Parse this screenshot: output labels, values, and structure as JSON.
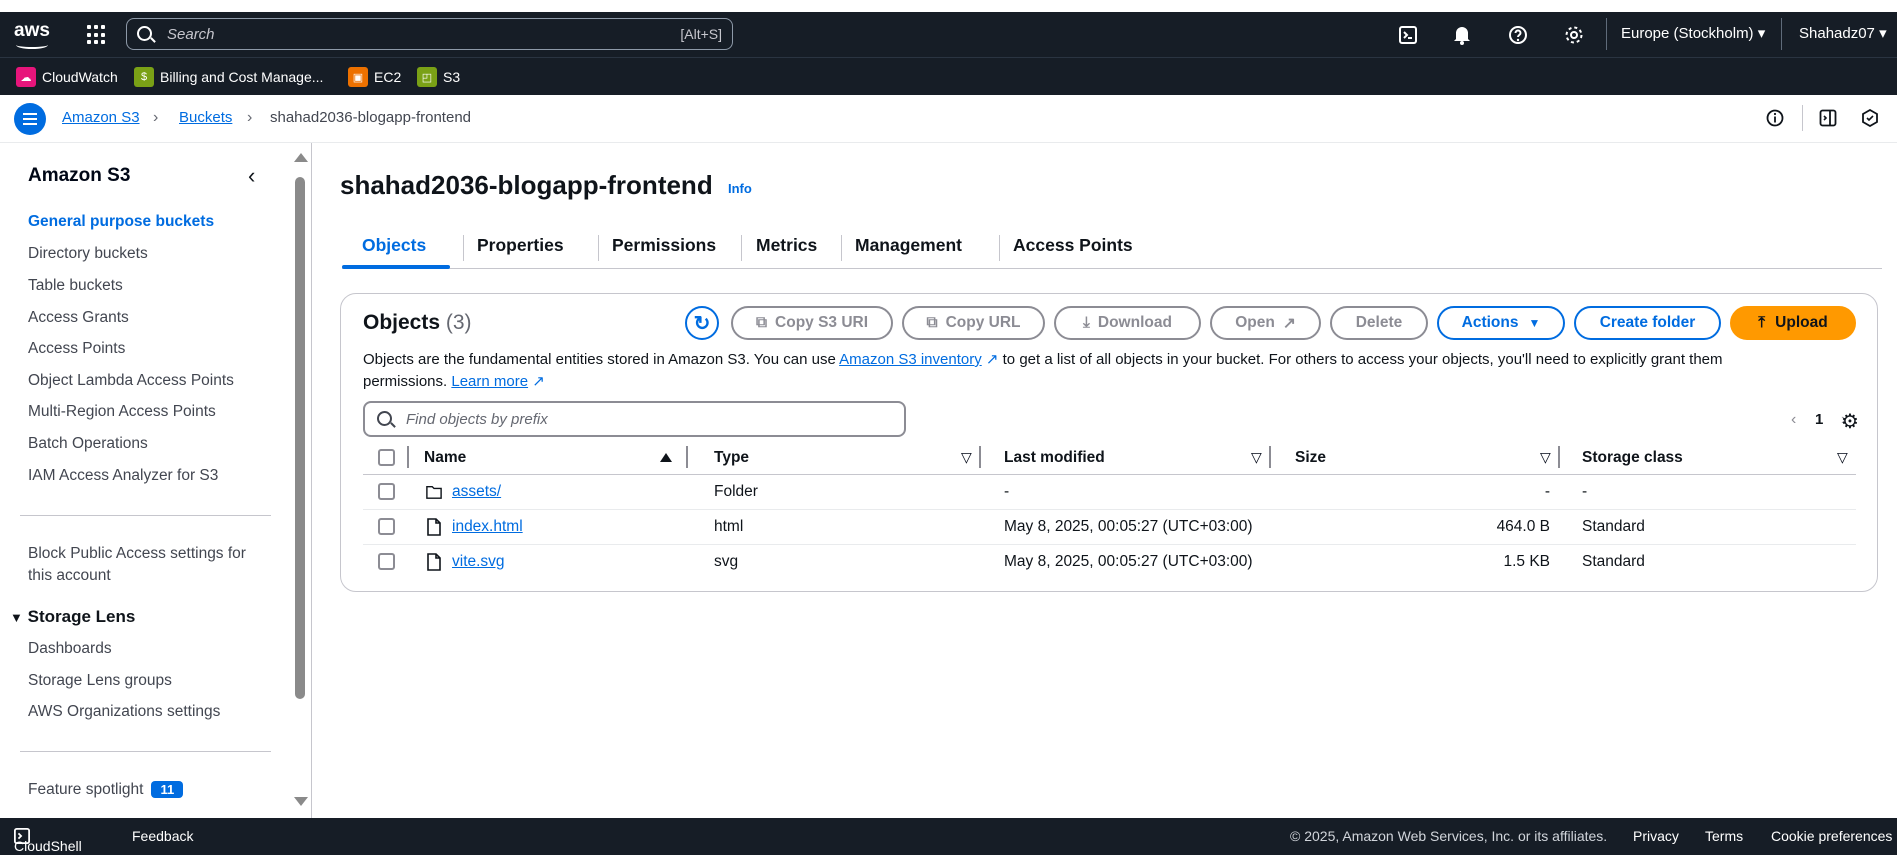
{
  "topbar": {
    "logo": "aws",
    "search_placeholder": "Search",
    "shortcut": "[Alt+S]",
    "region": "Europe (Stockholm)",
    "user": "Shahadz07"
  },
  "bookmarks": [
    {
      "label": "CloudWatch",
      "color": "#e7157b"
    },
    {
      "label": "Billing and Cost Manage...",
      "color": "#7aa116"
    },
    {
      "label": "EC2",
      "color": "#ed7100"
    },
    {
      "label": "S3",
      "color": "#7aa116"
    }
  ],
  "breadcrumb": {
    "items": [
      "Amazon S3",
      "Buckets"
    ],
    "current": "shahad2036-blogapp-frontend"
  },
  "sidebar": {
    "title": "Amazon S3",
    "items": [
      "General purpose buckets",
      "Directory buckets",
      "Table buckets",
      "Access Grants",
      "Access Points",
      "Object Lambda Access Points",
      "Multi-Region Access Points",
      "Batch Operations",
      "IAM Access Analyzer for S3"
    ],
    "block_public": "Block Public Access settings for",
    "block_public2": "this account",
    "storage_lens": "Storage Lens",
    "lens_items": [
      "Dashboards",
      "Storage Lens groups",
      "AWS Organizations settings"
    ],
    "spotlight": "Feature spotlight",
    "spotlight_count": "11"
  },
  "page": {
    "title": "shahad2036-blogapp-frontend",
    "info": "Info"
  },
  "tabs": [
    "Objects",
    "Properties",
    "Permissions",
    "Metrics",
    "Management",
    "Access Points"
  ],
  "objects": {
    "title": "Objects",
    "count": "(3)",
    "buttons": {
      "copy_uri": "Copy S3 URI",
      "copy_url": "Copy URL",
      "download": "Download",
      "open": "Open",
      "delete": "Delete",
      "actions": "Actions",
      "create_folder": "Create folder",
      "upload": "Upload"
    },
    "desc1": "Objects are the fundamental entities stored in Amazon S3. You can use ",
    "inventory": "Amazon S3 inventory",
    "desc2": " to get a list of all objects in your bucket. For others to access your objects, you'll need to explicitly grant them",
    "desc3": "permissions. ",
    "learn_more": "Learn more",
    "filter_placeholder": "Find objects by prefix",
    "page": "1",
    "columns": [
      "Name",
      "Type",
      "Last modified",
      "Size",
      "Storage class"
    ],
    "rows": [
      {
        "name": "assets/",
        "type": "Folder",
        "modified": "-",
        "size": "-",
        "class": "-"
      },
      {
        "name": "index.html",
        "type": "html",
        "modified": "May 8, 2025, 00:05:27 (UTC+03:00)",
        "size": "464.0 B",
        "class": "Standard"
      },
      {
        "name": "vite.svg",
        "type": "svg",
        "modified": "May 8, 2025, 00:05:27 (UTC+03:00)",
        "size": "1.5 KB",
        "class": "Standard"
      }
    ]
  },
  "footer": {
    "cloudshell": "CloudShell",
    "feedback": "Feedback",
    "copyright": "© 2025, Amazon Web Services, Inc. or its affiliates.",
    "privacy": "Privacy",
    "terms": "Terms",
    "cookies": "Cookie preferences"
  }
}
